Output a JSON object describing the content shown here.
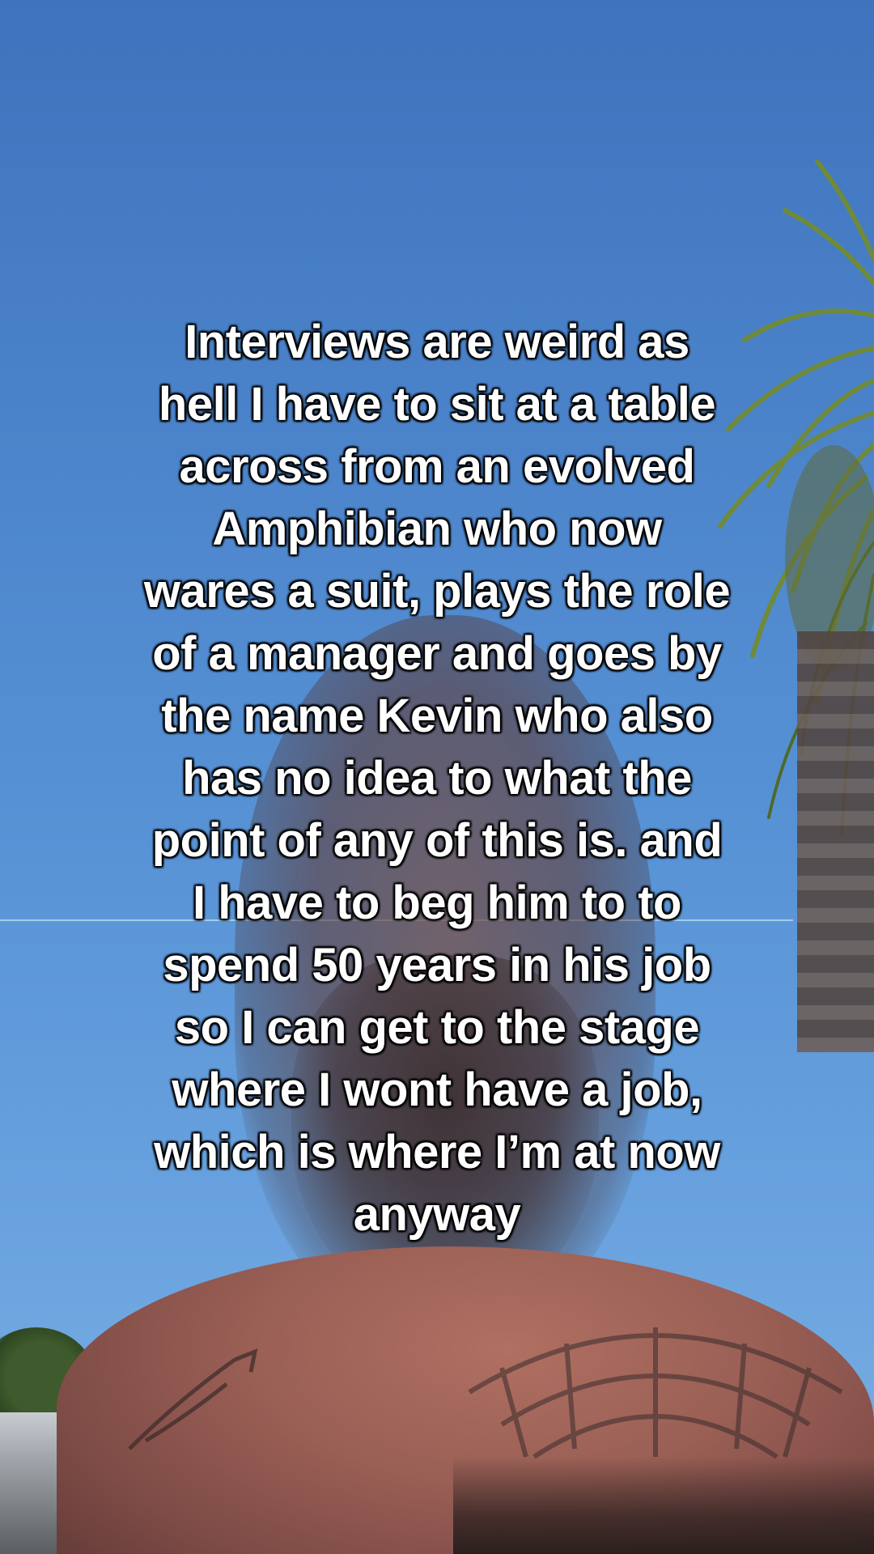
{
  "caption": {
    "lines": [
      "Interviews are weird as",
      "hell I have to sit at a table",
      "across from an evolved",
      "Amphibian who now",
      "wares a suit, plays the role",
      "of a manager and goes by",
      "the name Kevin who also",
      "has no idea to what the",
      "point of any of this is. and",
      "I have to beg him to to",
      "spend 50 years in his job",
      "so I can get to the stage",
      "where I wont have a job,",
      "which is where I’m at now",
      "anyway"
    ]
  },
  "colors": {
    "sky_top": "#3f73bd",
    "sky_bottom": "#7cb0e2",
    "text": "#ffffff",
    "text_outline": "#000000"
  }
}
